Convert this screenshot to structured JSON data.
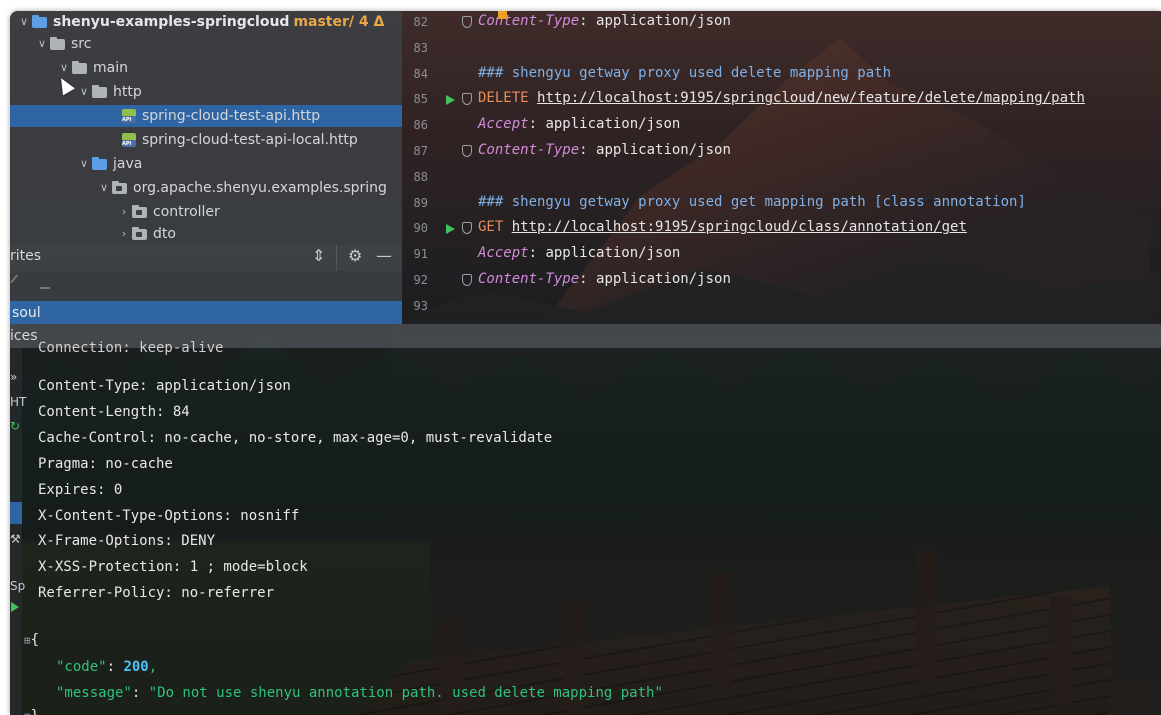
{
  "project": {
    "root": "shenyu-examples-springcloud",
    "branch": "master/ 4 Δ",
    "nodes": [
      "src",
      "main",
      "http",
      "spring-cloud-test-api.http",
      "spring-cloud-test-api-local.http",
      "java",
      "org.apache.shenyu.examples.spring",
      "controller",
      "dto"
    ]
  },
  "favorites": {
    "title": "rites",
    "item": "soul"
  },
  "services": {
    "title": "ices"
  },
  "editor": {
    "lines": [
      {
        "num": "82",
        "key": "Content-Type",
        "sep": ": ",
        "val": "application/json"
      },
      {
        "num": "83"
      },
      {
        "num": "84",
        "comment": "### shengyu getway proxy used delete mapping path"
      },
      {
        "num": "85",
        "method": "DELETE",
        "url": "http://localhost:9195/springcloud/new/feature/delete/mapping/path"
      },
      {
        "num": "86",
        "key": "Accept",
        "sep": ": ",
        "val": "application/json"
      },
      {
        "num": "87",
        "key": "Content-Type",
        "sep": ": ",
        "val": "application/json"
      },
      {
        "num": "88"
      },
      {
        "num": "89",
        "comment": "### shengyu getway proxy used get mapping path [class annotation]"
      },
      {
        "num": "90",
        "method": "GET",
        "url": "http://localhost:9195/springcloud/class/annotation/get"
      },
      {
        "num": "91",
        "key": "Accept",
        "sep": ": ",
        "val": "application/json"
      },
      {
        "num": "92",
        "key": "Content-Type",
        "sep": ": ",
        "val": "application/json"
      },
      {
        "num": "93"
      }
    ]
  },
  "response": {
    "partial_header": "Connection: keep-alive",
    "headers": [
      "Content-Type: application/json",
      "Content-Length: 84",
      "Cache-Control: no-cache, no-store, max-age=0, must-revalidate",
      "Pragma: no-cache",
      "Expires: 0",
      "X-Content-Type-Options: nosniff",
      "X-Frame-Options: DENY",
      "X-XSS-Protection: 1 ; mode=block",
      "Referrer-Policy: no-referrer"
    ],
    "open_brace": "{",
    "close_brace": "}",
    "body": {
      "code_key": "\"code\"",
      "code_val": "200",
      "message_key": "\"message\"",
      "message_val": "\"Do not use shenyu annotation path. used delete mapping path\""
    }
  },
  "sidebar_glyphs": [
    "»",
    "HT",
    "Sp"
  ],
  "colors": {
    "selection": "#2f65a3",
    "branch": "#e8a84a",
    "run": "#3fc15b",
    "json_key": "#2ec27e",
    "json_number": "#4fc3f7",
    "http_method": "#e78d5c",
    "comment": "#7fb0e6",
    "header_key": "#d28bd8"
  }
}
